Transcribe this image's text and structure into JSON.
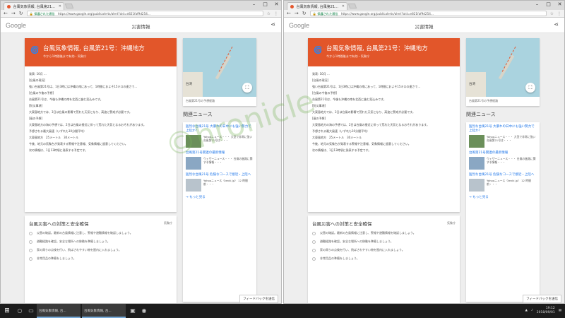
{
  "colors": {
    "hero": "#e2562a",
    "link": "#1a73e8",
    "secure": "#0b8043"
  },
  "browser": {
    "tab_title": "台風気象情報, 台風第21...",
    "url_secure_label": "保護された通信",
    "url": "https://www.google.org/publicalerts/alert?aid=e821faf9d254...",
    "tooltip": "台風気象情報, 台風第21号：沖縄地方"
  },
  "page": {
    "logo": "Google",
    "title": "災害情報",
    "hero_title": "台風気象情報, 台風第21号：沖縄地方",
    "hero_sub": "今から1時間後まで有効・気象庁",
    "body": [
      "発表: 10月 ...",
      "[台風の現況]",
      "強い台風第21号は、1日3時には沖縄の南にあって、1時間におよそ15キロの速さで...",
      "[台風の今後の予想]",
      "台風第21号は、今後も沖縄の南を北西に進む見込みです。",
      "[防災事項]",
      "大東島地方では、3日は台風の影響で荒れた天気となり、高波に警戒が必要です。",
      "[風の予想]",
      "大東島地方の海の予想では、2日は台風の接近に伴って荒れた天気となるおそれがあります。",
      "予想される最大風速（いずれも10分間平均）",
      "大東島地方　25メートル　30メートル",
      "今後、地元の気象台が発表する警報や注意報、気象情報に留意してください。",
      "次の情報は、1日13時頃に発表する予定です。"
    ],
    "map_label": "台湾",
    "map_caption": "台風第21号の予想経路",
    "news_title": "関連ニュース",
    "news": [
      {
        "headline": "猛烈な台風21号 大暴れの日中にも強い勢力で上陸か？",
        "snippet": "Yahooニュース・・・ 大型で非常に強い台風第21号は・・・"
      },
      {
        "headline": "台風第21号関連の最新情報",
        "snippet": "ウェザーニュース・・・ 台風の進路に関する情報・・・"
      },
      {
        "headline": "猛烈な台風21号 危険なコースで接近・上陸へ",
        "snippet": "Yahooニュース（tenki.jp） 12 時間前・・・"
      }
    ],
    "news_more": "もっと見る",
    "safety_title": "台風災害への対策と安全確保",
    "safety_source": "気象庁",
    "safety_steps": [
      "災害の確認。最新の台風情報に注意し、警報や避難情報を確認しましょう。",
      "避難経路を確認。安全な場所への移動を準備しましょう。",
      "家の周りの点検を行い、飛ばされやすい物を屋内に入れましょう。",
      "非常用品の準備をしましょう。"
    ],
    "feedback": "フィードバックを送信"
  },
  "watermark": "©hronicle",
  "taskbar": {
    "apps": [
      "台風気象情報, 台...",
      "台風気象情報, 台..."
    ],
    "time": "19:12",
    "date": "2018/09/01"
  }
}
